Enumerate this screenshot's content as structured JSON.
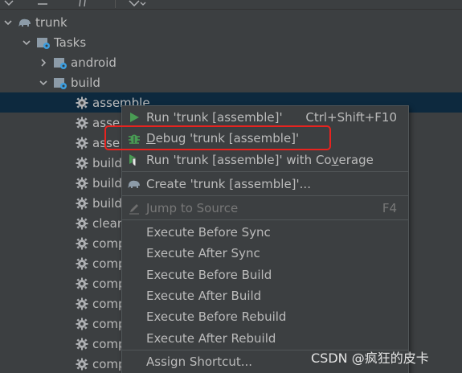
{
  "tree": {
    "root": {
      "label": "trunk",
      "icon": "elephant-icon"
    },
    "tasks": {
      "label": "Tasks",
      "icon": "folder-gear-icon"
    },
    "android": {
      "label": "android",
      "icon": "folder-gear-icon"
    },
    "build_group": {
      "label": "build",
      "icon": "folder-gear-icon"
    },
    "items": [
      {
        "label": "assemble"
      },
      {
        "label": "asse"
      },
      {
        "label": "asse"
      },
      {
        "label": "build"
      },
      {
        "label": "build"
      },
      {
        "label": "build"
      },
      {
        "label": "clean"
      },
      {
        "label": "comp"
      },
      {
        "label": "comp"
      },
      {
        "label": "comp"
      },
      {
        "label": "comp"
      },
      {
        "label": "comp"
      },
      {
        "label": "comp"
      },
      {
        "label": "comp"
      }
    ]
  },
  "context_menu": {
    "run": {
      "label": "Run 'trunk [assemble]'",
      "shortcut": "Ctrl+Shift+F10",
      "icon": "run-icon"
    },
    "debug": {
      "label_prefix": "D",
      "label_rest": "ebug 'trunk [assemble]'",
      "icon": "debug-icon"
    },
    "coverage": {
      "label_before": "Run 'trunk [assemble]' with Co",
      "label_mnemonic": "v",
      "label_after": "erage",
      "icon": "coverage-icon"
    },
    "create": {
      "label": "Create 'trunk [assemble]'...",
      "icon": "gradle-icon"
    },
    "jump": {
      "label": "Jump to Source",
      "shortcut": "F4",
      "icon": "pencil-icon"
    },
    "execute_items": [
      {
        "label": "Execute Before Sync"
      },
      {
        "label": "Execute After Sync"
      },
      {
        "label": "Execute Before Build"
      },
      {
        "label": "Execute After Build"
      },
      {
        "label": "Execute Before Rebuild"
      },
      {
        "label": "Execute After Rebuild"
      }
    ],
    "assign": {
      "label": "Assign Shortcut..."
    }
  },
  "watermark": "CSDN @疯狂的皮卡",
  "colors": {
    "background": "#3c3f41",
    "selection": "#0d293e",
    "text": "#bbbbbb",
    "highlight_border": "#e8231f",
    "run_green": "#499c54"
  }
}
